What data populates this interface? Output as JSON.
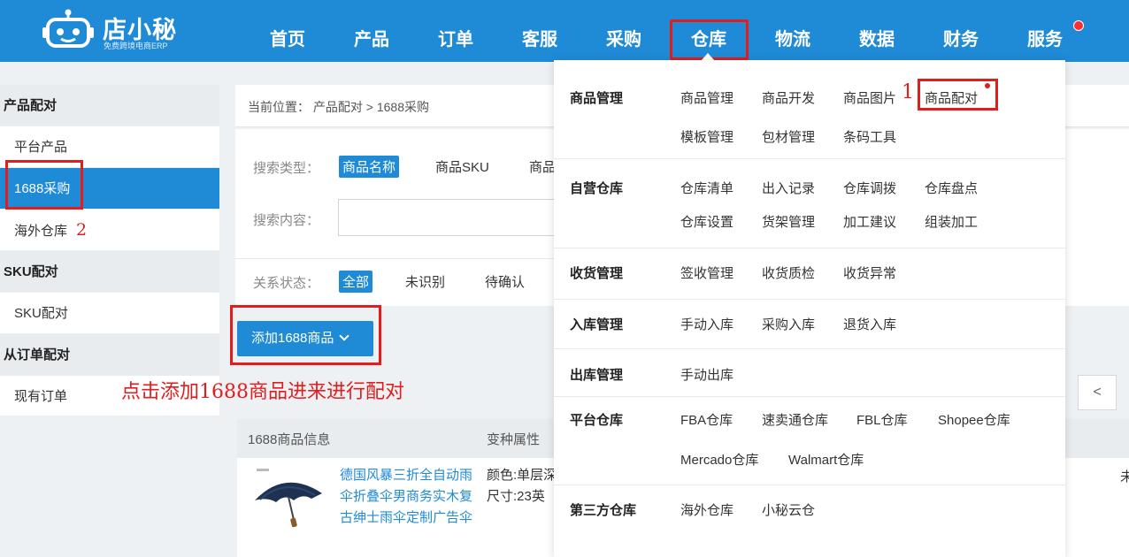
{
  "logo": {
    "title": "店小秘",
    "subtitle": "免费跨境电商ERP"
  },
  "nav": {
    "items": [
      "首页",
      "产品",
      "订单",
      "客服",
      "采购",
      "仓库",
      "物流",
      "数据",
      "财务",
      "服务"
    ],
    "active": "仓库"
  },
  "sidebar": {
    "group1": "产品配对",
    "item1": "平台产品",
    "item2": "1688采购",
    "item3": "海外仓库",
    "item3_num": "2",
    "group2": "SKU配对",
    "item4": "SKU配对",
    "group3": "从订单配对",
    "item5": "现有订单"
  },
  "breadcrumb": "当前位置：  产品配对 > 1688采购",
  "filters": {
    "search_type_label": "搜索类型：",
    "search_type_options": [
      "商品名称",
      "商品SKU",
      "商品"
    ],
    "search_content_label": "搜索内容：",
    "status_label": "关系状态：",
    "status_options": [
      "全部",
      "未识别",
      "待确认"
    ]
  },
  "add_button": "添加1688商品",
  "annotation": {
    "step1": "1",
    "main_hint": "点击添加1688商品进来进行配对"
  },
  "table": {
    "col1": "1688商品信息",
    "col2": "变种属性",
    "row1": {
      "name": "德国风暴三折全自动雨伞折叠伞男商务实木复古绅士雨伞定制广告伞",
      "attr1": "颜色:单层深",
      "attr2": "尺寸:23英"
    },
    "edge": "未"
  },
  "pager": {
    "prev": "<"
  },
  "dropdown": {
    "sections": [
      {
        "title": "商品管理",
        "rows": [
          [
            "商品管理",
            "商品开发",
            "商品图片",
            "商品配对"
          ],
          [
            "模板管理",
            "包材管理",
            "条码工具"
          ]
        ]
      },
      {
        "title": "自营仓库",
        "rows": [
          [
            "仓库清单",
            "出入记录",
            "仓库调拨",
            "仓库盘点"
          ],
          [
            "仓库设置",
            "货架管理",
            "加工建议",
            "组装加工"
          ]
        ]
      },
      {
        "title": "收货管理",
        "rows": [
          [
            "签收管理",
            "收货质检",
            "收货异常"
          ]
        ]
      },
      {
        "title": "入库管理",
        "rows": [
          [
            "手动入库",
            "采购入库",
            "退货入库"
          ]
        ]
      },
      {
        "title": "出库管理",
        "rows": [
          [
            "手动出库"
          ]
        ]
      },
      {
        "title": "平台仓库",
        "rows": [
          [
            "FBA仓库",
            "速卖通仓库",
            "FBL仓库",
            "Shopee仓库"
          ],
          [
            "Mercado仓库",
            "Walmart仓库"
          ]
        ]
      },
      {
        "title": "第三方仓库",
        "rows": [
          [
            "海外仓库",
            "小秘云仓"
          ]
        ]
      }
    ]
  },
  "colors": {
    "primary": "#1f8ad6",
    "annotation_red": "#e31c1c"
  }
}
